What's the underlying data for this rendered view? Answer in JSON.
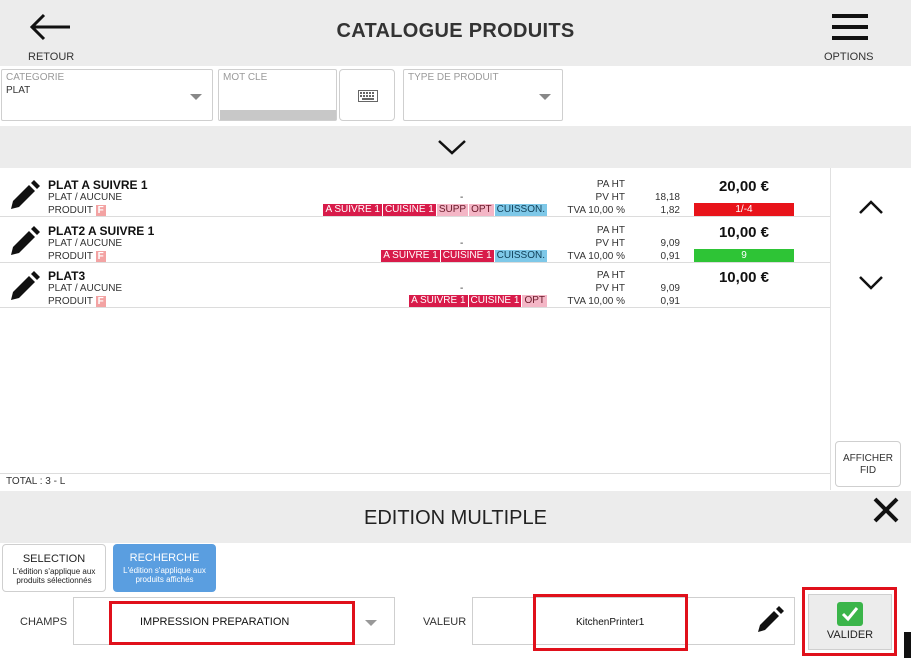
{
  "header": {
    "title": "CATALOGUE PRODUITS",
    "back_label": "RETOUR",
    "options_label": "OPTIONS"
  },
  "filters": {
    "categorie": {
      "caption": "CATEGORIE",
      "value": "PLAT"
    },
    "mot_cle": {
      "caption": "MOT CLE",
      "value": ""
    },
    "type_produit": {
      "caption": "TYPE DE PRODUIT",
      "value": ""
    }
  },
  "products": [
    {
      "name": "PLAT A SUIVRE 1",
      "sub": "PLAT / AUCUNE",
      "produit_label": "PRODUIT",
      "produit_flag": "F",
      "dash": "-",
      "tags": [
        {
          "text": "A SUIVRE 1",
          "style": "red"
        },
        {
          "text": "CUISINE 1",
          "style": "red"
        },
        {
          "text": "SUPP",
          "style": "pink"
        },
        {
          "text": "OPT",
          "style": "pink"
        },
        {
          "text": "CUISSON.",
          "style": "blue"
        }
      ],
      "pa_label": "PA HT",
      "pa_value": "",
      "pv_label": "PV HT",
      "pv_value": "18,18",
      "tva_label": "TVA 10,00 %",
      "tva_value": "1,82",
      "price": "20,00 €",
      "stock": "1/-4",
      "stock_color": "#e8131a"
    },
    {
      "name": "PLAT2 A SUIVRE 1",
      "sub": "PLAT / AUCUNE",
      "produit_label": "PRODUIT",
      "produit_flag": "F",
      "dash": "-",
      "tags": [
        {
          "text": "A SUIVRE 1",
          "style": "red"
        },
        {
          "text": "CUISINE 1",
          "style": "red"
        },
        {
          "text": "CUISSON.",
          "style": "blue"
        }
      ],
      "pa_label": "PA HT",
      "pa_value": "",
      "pv_label": "PV HT",
      "pv_value": "9,09",
      "tva_label": "TVA 10,00 %",
      "tva_value": "0,91",
      "price": "10,00 €",
      "stock": "9",
      "stock_color": "#2ec436"
    },
    {
      "name": "PLAT3",
      "sub": "PLAT / AUCUNE",
      "produit_label": "PRODUIT",
      "produit_flag": "F",
      "dash": "-",
      "tags": [
        {
          "text": "A SUIVRE 1",
          "style": "red"
        },
        {
          "text": "CUISINE 1",
          "style": "red"
        },
        {
          "text": "OPT",
          "style": "pink"
        }
      ],
      "pa_label": "PA HT",
      "pa_value": "",
      "pv_label": "PV HT",
      "pv_value": "9,09",
      "tva_label": "TVA 10,00 %",
      "tva_value": "0,91",
      "price": "10,00 €",
      "stock": "",
      "stock_color": ""
    }
  ],
  "list": {
    "total": "TOTAL : 3 - L"
  },
  "side": {
    "afficher_fid": "AFFICHER FID"
  },
  "edition": {
    "title": "EDITION MULTIPLE",
    "selection_title": "SELECTION",
    "selection_desc": "L'édition s'applique aux produits sélectionnés",
    "recherche_title": "RECHERCHE",
    "recherche_desc": "L'édition s'applique aux produits affichés",
    "champs_label": "CHAMPS",
    "champs_value": "IMPRESSION PREPARATION",
    "valeur_label": "VALEUR",
    "valeur_value": "KitchenPrinter1",
    "valider_label": "VALIDER"
  },
  "colors": {
    "accent_blue": "#5a9ee0",
    "highlight_red": "#e0101b",
    "valider_green": "#3bb54a"
  }
}
